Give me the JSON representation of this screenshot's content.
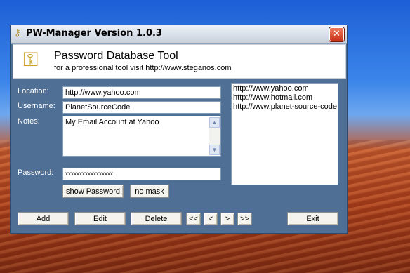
{
  "window": {
    "title": "PW-Manager Version 1.0.3",
    "close_label": "✕"
  },
  "banner": {
    "title": "Password Database Tool",
    "subtitle": "for a professional tool visit http://www.steganos.com"
  },
  "form": {
    "location_label": "Location:",
    "location_value": "http://www.yahoo.com",
    "username_label": "Username:",
    "username_value": "PlanetSourceCode",
    "notes_label": "Notes:",
    "notes_value": "My Email Account at Yahoo",
    "password_label": "Password:",
    "password_value": "xxxxxxxxxxxxxxxxx",
    "show_password_label": "show Password",
    "no_mask_label": "no mask"
  },
  "list": {
    "items": [
      "http://www.yahoo.com",
      "http://www.hotmail.com",
      "http://www.planet-source-code"
    ]
  },
  "toolbar": {
    "add_label": "Add",
    "edit_label": "Edit",
    "delete_label": "Delete",
    "first_label": "<<",
    "prev_label": "<",
    "next_label": ">",
    "last_label": ">>",
    "exit_label": "Exit"
  }
}
